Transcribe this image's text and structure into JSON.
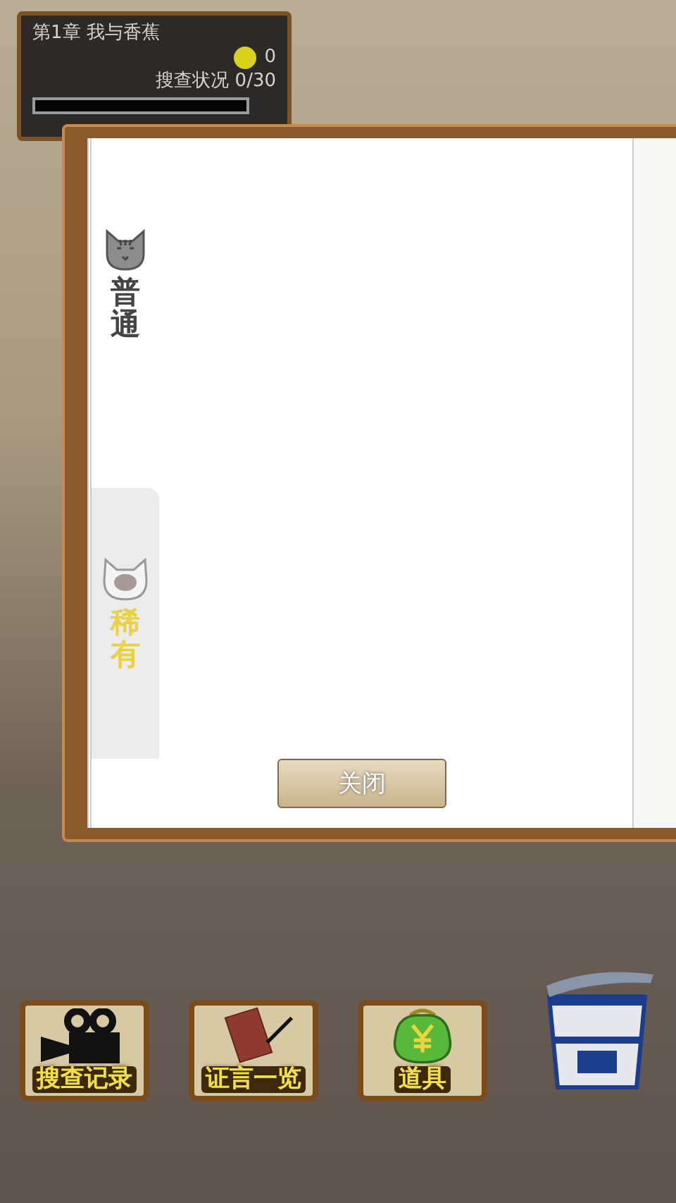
{
  "status_panel": {
    "chapter": "第1章 我与香蕉",
    "coins": "0",
    "progress_label": "搜查状况 0/30",
    "level": 0
  },
  "tabs": [
    {
      "label": "普通",
      "selected": true,
      "kind": "tabby"
    },
    {
      "label": "稀有",
      "selected": false,
      "kind": "fluffy"
    }
  ],
  "close_button": "关闭",
  "menu_buttons": [
    {
      "label": "搜查记录",
      "kind": "camera"
    },
    {
      "label": "证言一览",
      "kind": "notebook"
    },
    {
      "label": "道具",
      "kind": "purse"
    }
  ]
}
